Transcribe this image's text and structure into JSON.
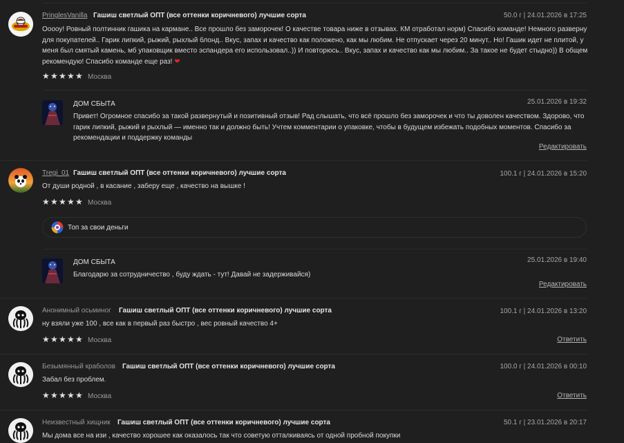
{
  "reviews": [
    {
      "user": "PringlesVanilla",
      "product": "Гашиш светлый ОПТ (все оттенки коричневого) лучшие сорта",
      "meta": "50.0 г | 24.01.2026 в 17:25",
      "text": "Ооооу! Ровный полтинник гашика на кармане.. Все прошло без заморочек! О качестве товара ниже в отзывах. КМ отработал норм) Спасибо команде! Немного разверну для покупателей.. Гарик липкий, рыжий, рыхлый блонд.. Вкус, запах и качество как положено, как мы любим. Не отпускает через 20 минут.. Но! Гашик идет не плитой, у меня был смятый камень, мб упаковщик вместо эспандера его использовал..)) И повторюсь.. Вкус, запах и качество как мы любим.. За такое не будет стыдно)) В общем рекомендую! Спасибо команде еще раз!",
      "heart": "❤",
      "city": "Москва",
      "avatar_icon": "pringles-logo-icon"
    },
    {
      "user": "Tregi_01",
      "product": "Гашиш светлый ОПТ (все оттенки коричневого) лучшие сорта",
      "meta": "100.1 г | 24.01.2026 в 15:20",
      "text": "От души родной , в касание , заберу еще , качество на вышке !",
      "city": "Москва",
      "avatar_icon": "panda-sunset-icon"
    },
    {
      "user": "Анонимный осьминог",
      "product": "Гашиш светлый ОПТ (все оттенки коричневого) лучшие сорта",
      "meta": "100.1 г | 24.01.2026 в 13:20",
      "text": "ну взяли уже 100 , все как в первый раз быстро , вес ровный качество 4+",
      "city": "Москва",
      "action": "Ответить",
      "avatar_icon": "octopus-icon"
    },
    {
      "user": "Безымянный краболов",
      "product": "Гашиш светлый ОПТ (все оттенки коричневого) лучшие сорта",
      "meta": "100.0 г | 24.01.2026 в 00:10",
      "text": "Забал без проблем.",
      "city": "Москва",
      "action": "Ответить",
      "avatar_icon": "octopus-icon"
    },
    {
      "user": "Неизвестный хищник",
      "product": "Гашиш светлый ОПТ (все оттенки коричневого) лучшие сорта",
      "meta": "50.1 г | 23.01.2026 в 20:17",
      "text": "Мы дома все на изи , качество хорошее как оказалось так что советую отталкиваясь от одной пробной покупки",
      "avatar_icon": "octopus-icon"
    }
  ],
  "replies": [
    {
      "shop": "ДОМ СБЫТА",
      "date": "25.01.2026 в 19:32",
      "text": "Привет! Огромное спасибо за такой развернутый и позитивный отзыв! Рад слышать, что всё прошло без заморочек и что ты доволен качеством. Здорово, что гарик липкий, рыжий и рыхлый — именно так и должно быть! Учтем комментарии о упаковке, чтобы в будущем избежать подобных моментов. Спасибо за рекомендации и поддержку команды",
      "action": "Редактировать"
    },
    {
      "shop": "ДОМ СБЫТА",
      "date": "25.01.2026 в 19:40",
      "text": "Благодарю за сотрудничество , буду ждать - тут! Давай не задерживайся)",
      "action": "Редактировать"
    }
  ],
  "badge": {
    "label": "Топ за свои деньги"
  },
  "stars": {
    "count": 5,
    "max": 5,
    "glyph": "★"
  },
  "colors": {
    "background": "#1f1f1f",
    "heart": "#e02424",
    "divider": "#2c2c2c"
  }
}
